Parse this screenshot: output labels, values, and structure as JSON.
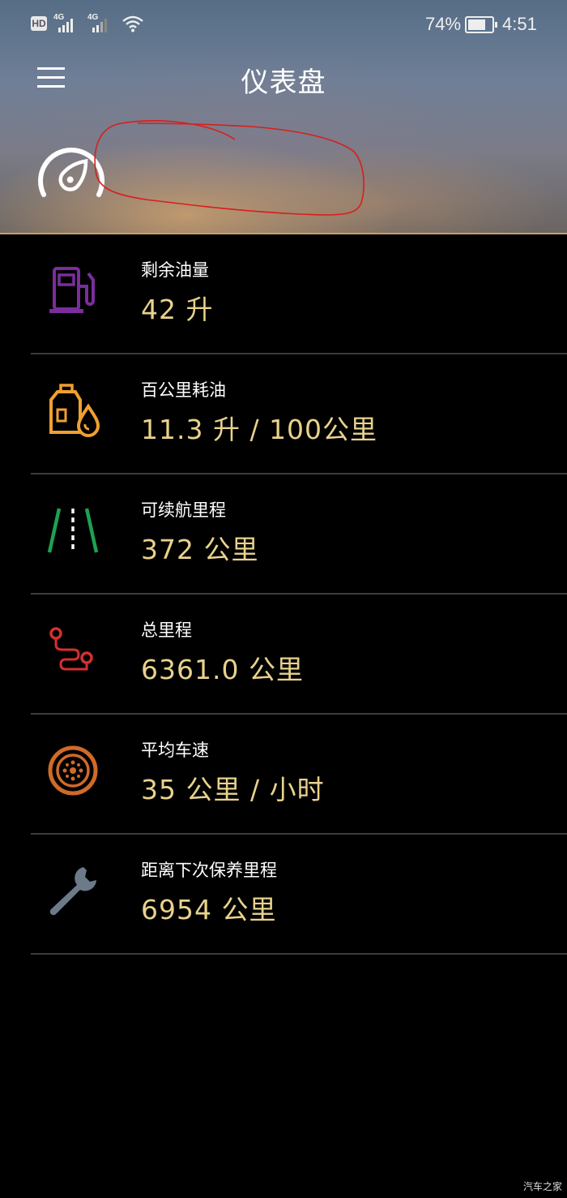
{
  "status_bar": {
    "hd": "HD",
    "net1": "4G",
    "net2": "4G",
    "battery_pct": "74%",
    "battery_level": 0.74,
    "time": "4:51"
  },
  "header": {
    "title": "仪表盘"
  },
  "items": [
    {
      "label": "剩余油量",
      "value": "42 升",
      "icon": "fuel-pump-icon",
      "color": "#7a2d9c"
    },
    {
      "label": "百公里耗油",
      "value": "11.3 升 / 100公里",
      "icon": "oil-can-icon",
      "color": "#f0a030"
    },
    {
      "label": "可续航里程",
      "value": "372 公里",
      "icon": "road-icon",
      "color": "#1fa050"
    },
    {
      "label": "总里程",
      "value": "6361.0 公里",
      "icon": "route-icon",
      "color": "#d23030"
    },
    {
      "label": "平均车速",
      "value": "35 公里 / 小时",
      "icon": "wheel-icon",
      "color": "#d06a28"
    },
    {
      "label": "距离下次保养里程",
      "value": "6954 公里",
      "icon": "wrench-icon",
      "color": "#6c7a89"
    }
  ],
  "watermark": "汽车之家"
}
